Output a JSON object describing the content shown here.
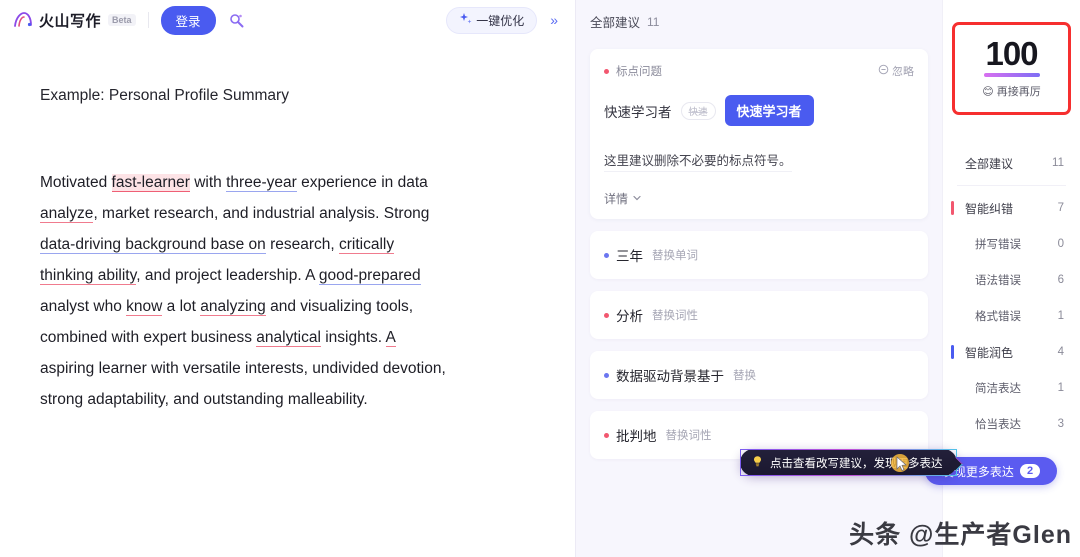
{
  "header": {
    "logo_text": "火山写作",
    "beta_badge": "Beta",
    "login_label": "登录",
    "magic_icon": "magic-wand-icon",
    "optimize_label": "一键优化",
    "optimize_icon": "sparkle-icon",
    "collapse_icon": "»"
  },
  "document": {
    "title": "Example: Personal Profile Summary",
    "body_lines": [
      "Motivated fast-learner with three-year experience in data",
      "analyze, market research, and industrial analysis. Strong",
      "data-driving background base on research, critically",
      "thinking ability, and project leadership. A good-prepared",
      "analyst who know a lot analyzing and visualizing tools,",
      "combined with expert business analytical insights. A",
      "aspiring learner with versatile interests, undivided devotion,",
      "strong adaptability, and outstanding malleability."
    ],
    "segments": {
      "s1a": "Motivated ",
      "s1b": "fast-learner",
      "s1c": " with ",
      "s1d": "three-year",
      "s1e": " experience in data",
      "s2a": "analyze",
      "s2b": ", market research, and industrial analysis. Strong",
      "s3a": "data-driving background base on",
      "s3b": " research, ",
      "s3c": "critically",
      "s4a": "thinking ability",
      "s4b": ", and project leadership. A ",
      "s4c": "good-prepared",
      "s5a": "analyst who ",
      "s5b": "know",
      "s5c": " a lot ",
      "s5d": "analyzing",
      "s5e": " and visualizing tools,",
      "s6a": "combined with expert business ",
      "s6b": "analytical",
      "s6c": " insights. ",
      "s6d": "A",
      "s7": "aspiring learner with versatile interests, undivided devotion,",
      "s8": "strong adaptability, and outstanding malleability."
    }
  },
  "suggestions_panel": {
    "header_label": "全部建议",
    "header_count": "11",
    "card": {
      "tag": "标点问题",
      "ignore_label": "忽略",
      "ignore_icon": "circle-minus-icon",
      "original": "快速学习者",
      "original_strike": "快速",
      "replacement": "快速学习者",
      "description": "这里建议删除不必要的标点符号。",
      "detail_label": "详情",
      "detail_icon": "chevron-down-icon"
    },
    "rows": [
      {
        "word": "三年",
        "action": "替换单词",
        "dot": "blue"
      },
      {
        "word": "分析",
        "action": "替换词性",
        "dot": "red"
      },
      {
        "word": "数据驱动背景基于",
        "action": "替换",
        "dot": "blue"
      },
      {
        "word": "批判地",
        "action": "替换词性",
        "dot": "red"
      }
    ],
    "tooltip": {
      "icon": "lightbulb-icon",
      "text": "点击查看改写建议，发现更多表达"
    }
  },
  "watermark": "头条 @生产者Glen",
  "sidebar": {
    "score": "100",
    "score_emoji": "😊",
    "score_label": "再接再厉",
    "items": [
      {
        "label": "全部建议",
        "count": "11",
        "type": "total",
        "bar": ""
      },
      {
        "label": "智能纠错",
        "count": "7",
        "type": "group",
        "bar": "red"
      },
      {
        "label": "拼写错误",
        "count": "0",
        "type": "sub",
        "bar": ""
      },
      {
        "label": "语法错误",
        "count": "6",
        "type": "sub",
        "bar": ""
      },
      {
        "label": "格式错误",
        "count": "1",
        "type": "sub",
        "bar": ""
      },
      {
        "label": "智能润色",
        "count": "4",
        "type": "group",
        "bar": "blue"
      },
      {
        "label": "简洁表达",
        "count": "1",
        "type": "sub",
        "bar": ""
      },
      {
        "label": "恰当表达",
        "count": "3",
        "type": "sub",
        "bar": ""
      }
    ],
    "more_button": {
      "label": "发现更多表达",
      "count": "2"
    }
  },
  "colors": {
    "brand_blue": "#4a5bf0",
    "error_red": "#f2576f",
    "highlight_red": "#f62f2f",
    "panel_bg": "#f7f6fd"
  }
}
